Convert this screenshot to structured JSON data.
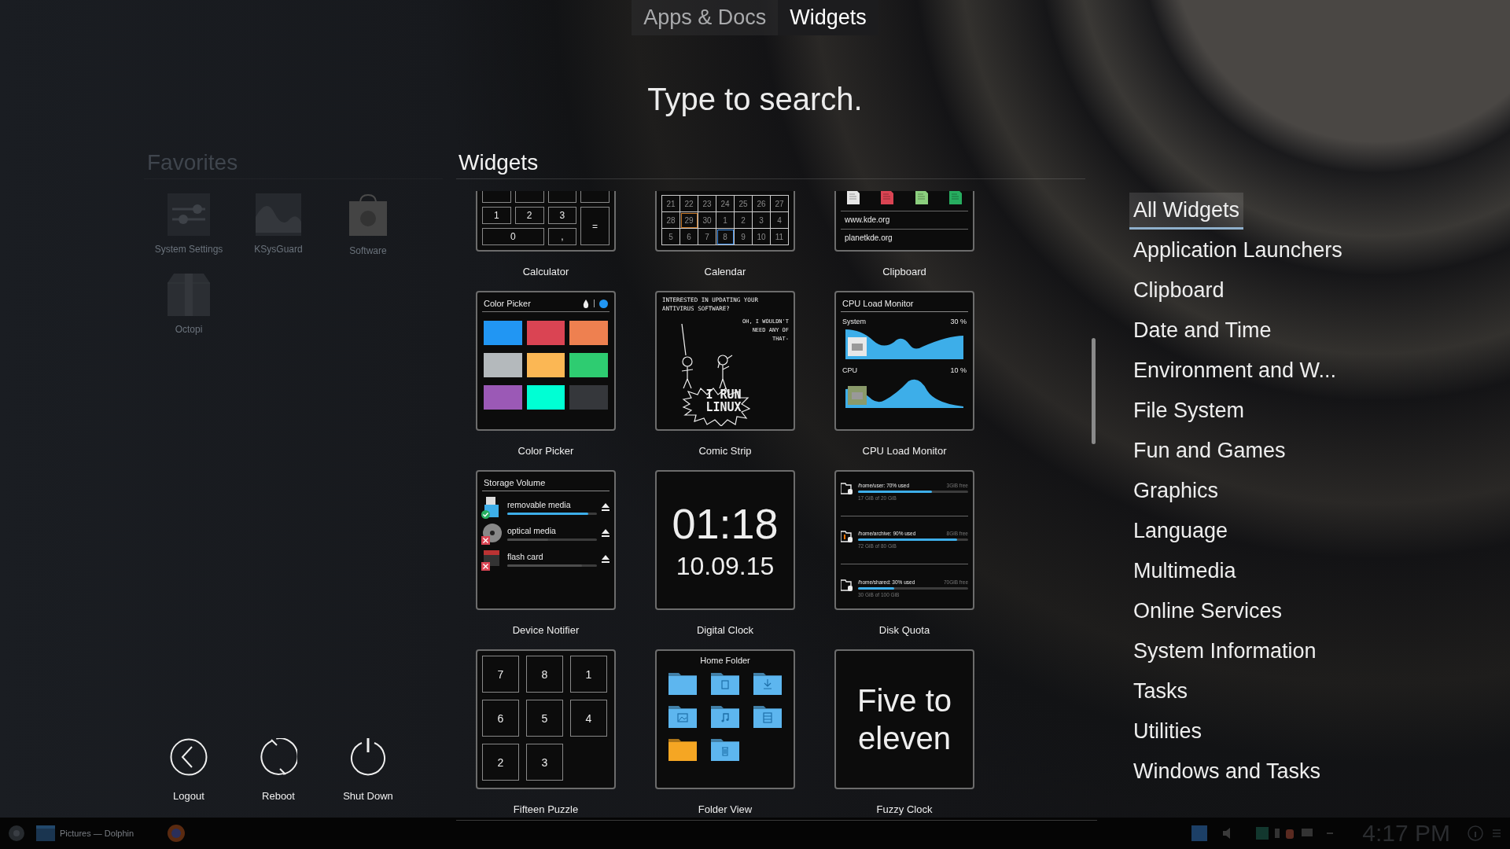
{
  "top_tabs": [
    {
      "label": "Apps & Docs",
      "selected": false
    },
    {
      "label": "Widgets",
      "selected": true
    }
  ],
  "search": {
    "placeholder": "Type to search."
  },
  "favorites": {
    "title": "Favorites",
    "items": [
      {
        "label": "System Settings",
        "kind": "settings"
      },
      {
        "label": "KSysGuard",
        "kind": "monitor"
      },
      {
        "label": "Software",
        "kind": "store"
      },
      {
        "label": "Octopi",
        "kind": "package"
      }
    ]
  },
  "power": [
    {
      "label": "Logout",
      "kind": "logout"
    },
    {
      "label": "Reboot",
      "kind": "reboot"
    },
    {
      "label": "Shut Down",
      "kind": "shutdown"
    }
  ],
  "widgets": {
    "title": "Widgets",
    "items": [
      {
        "label": "Calculator",
        "kind": "calculator",
        "preview": {
          "keys": [
            "1",
            "2",
            "3",
            "0",
            ",",
            "="
          ]
        }
      },
      {
        "label": "Calendar",
        "kind": "calendar",
        "preview": {
          "days": [
            {
              "day": "21",
              "today": false,
              "selected": false
            },
            {
              "day": "22",
              "today": false,
              "selected": false
            },
            {
              "day": "23",
              "today": false,
              "selected": false
            },
            {
              "day": "24",
              "today": false,
              "selected": false
            },
            {
              "day": "25",
              "today": false,
              "selected": false
            },
            {
              "day": "26",
              "today": false,
              "selected": false
            },
            {
              "day": "27",
              "today": false,
              "selected": false
            },
            {
              "day": "28",
              "today": false,
              "selected": false
            },
            {
              "day": "29",
              "today": true,
              "selected": false
            },
            {
              "day": "30",
              "today": false,
              "selected": false
            },
            {
              "day": "1",
              "today": false,
              "selected": false
            },
            {
              "day": "2",
              "today": false,
              "selected": false
            },
            {
              "day": "3",
              "today": false,
              "selected": false
            },
            {
              "day": "4",
              "today": false,
              "selected": false
            },
            {
              "day": "5",
              "today": false,
              "selected": false
            },
            {
              "day": "6",
              "today": false,
              "selected": false
            },
            {
              "day": "7",
              "today": false,
              "selected": false
            },
            {
              "day": "8",
              "today": false,
              "selected": true
            },
            {
              "day": "9",
              "today": false,
              "selected": false
            },
            {
              "day": "10",
              "today": false,
              "selected": false
            },
            {
              "day": "11",
              "today": false,
              "selected": false
            }
          ]
        }
      },
      {
        "label": "Clipboard",
        "kind": "clipboard",
        "preview": {
          "icons": [
            {
              "color": "#e6e6e6"
            },
            {
              "color": "#da4453"
            },
            {
              "color": "#8ccf7e"
            },
            {
              "color": "#27ae60"
            }
          ],
          "entries": [
            "www.kde.org",
            "planetkde.org"
          ]
        }
      },
      {
        "label": "Color Picker",
        "kind": "colorpicker",
        "preview": {
          "title": "Color Picker",
          "current": {
            "color": "#2196f3"
          },
          "swatches": [
            {
              "color": "#2196f3"
            },
            {
              "color": "#da4453"
            },
            {
              "color": "#ee8050"
            },
            {
              "color": "#b4b9bc"
            },
            {
              "color": "#fbb754"
            },
            {
              "color": "#2ecc71"
            },
            {
              "color": "#9b59b6"
            },
            {
              "color": "#00ffd4"
            },
            {
              "color": "#35373b"
            }
          ]
        }
      },
      {
        "label": "Comic Strip",
        "kind": "comic",
        "preview": {
          "caption": "INTERESTED IN UPDATING YOUR ANTIVIRUS SOFTWARE?",
          "reply": "OH, I WOULDN'T NEED ANY OF THAT-",
          "shout": "I RUN LINUX"
        }
      },
      {
        "label": "CPU Load Monitor",
        "kind": "cpu",
        "preview": {
          "title": "CPU Load Monitor",
          "rows": [
            {
              "label": "System",
              "value": "30 %"
            },
            {
              "label": "CPU",
              "value": "10 %"
            }
          ]
        }
      },
      {
        "label": "Device Notifier",
        "kind": "storage",
        "preview": {
          "title": "Storage Volume",
          "devices": [
            {
              "name": "removable media",
              "kind": "usb",
              "mounted": true,
              "level": 0.9
            },
            {
              "name": "optical media",
              "kind": "disc",
              "mounted": false,
              "level": 0.46
            },
            {
              "name": "flash card",
              "kind": "card",
              "mounted": false,
              "level": 0.83
            }
          ]
        }
      },
      {
        "label": "Digital Clock",
        "kind": "clock",
        "preview": {
          "time": "01:18",
          "date": "10.09.15"
        }
      },
      {
        "label": "Disk Quota",
        "kind": "quota",
        "preview": {
          "rows": [
            {
              "path": "/home/user: 70% used",
              "free": "3GiB free",
              "usage": "17 GiB of 20 GiB",
              "level": 0.67,
              "warning": false
            },
            {
              "path": "/home/archive: 90% used",
              "free": "8GiB free",
              "usage": "72 GiB of 80 GiB",
              "level": 0.9,
              "warning": true
            },
            {
              "path": "/home/shared: 30% used",
              "free": "70GiB free",
              "usage": "30 GiB of 100 GiB",
              "level": 0.33,
              "warning": false
            }
          ]
        }
      },
      {
        "label": "Fifteen Puzzle",
        "kind": "puzzle",
        "preview": {
          "tiles": [
            "7",
            "8",
            "1",
            "6",
            "5",
            "4",
            "2",
            "3"
          ]
        }
      },
      {
        "label": "Folder View",
        "kind": "folder",
        "preview": {
          "title": "Home Folder",
          "folders": [
            {
              "kind": "plain",
              "color": "#5db6ef"
            },
            {
              "kind": "document",
              "color": "#5db6ef"
            },
            {
              "kind": "download",
              "color": "#5db6ef"
            },
            {
              "kind": "image",
              "color": "#5db6ef"
            },
            {
              "kind": "music",
              "color": "#5db6ef"
            },
            {
              "kind": "video",
              "color": "#5db6ef"
            },
            {
              "kind": "plain",
              "color": "#f5a623"
            },
            {
              "kind": "trash",
              "color": "#5db6ef"
            }
          ]
        }
      },
      {
        "label": "Fuzzy Clock",
        "kind": "fuzzy",
        "preview": {
          "text": "Five to eleven"
        }
      }
    ]
  },
  "categories": [
    {
      "label": "All Widgets",
      "selected": true
    },
    {
      "label": "Application Launchers",
      "selected": false
    },
    {
      "label": "Clipboard",
      "selected": false
    },
    {
      "label": "Date and Time",
      "selected": false
    },
    {
      "label": "Environment and W...",
      "selected": false
    },
    {
      "label": "File System",
      "selected": false
    },
    {
      "label": "Fun and Games",
      "selected": false
    },
    {
      "label": "Graphics",
      "selected": false
    },
    {
      "label": "Language",
      "selected": false
    },
    {
      "label": "Multimedia",
      "selected": false
    },
    {
      "label": "Online Services",
      "selected": false
    },
    {
      "label": "System Information",
      "selected": false
    },
    {
      "label": "Tasks",
      "selected": false
    },
    {
      "label": "Utilities",
      "selected": false
    },
    {
      "label": "Windows and Tasks",
      "selected": false
    }
  ],
  "taskbar": {
    "task": "Pictures — Dolphin",
    "clock": "4:17 PM"
  }
}
